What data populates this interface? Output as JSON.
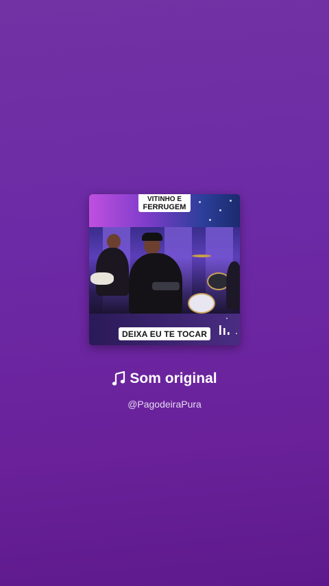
{
  "cover": {
    "title_line1": "VITINHO E",
    "title_line2": "FERRUGEM",
    "caption": "DEIXA EU TE TOCAR",
    "indicator_icon": "audio-bars-icon"
  },
  "sound": {
    "icon": "music-note-icon",
    "title": "Som original",
    "author": "@PagodeiraPura"
  },
  "colors": {
    "background_top": "#7232a3",
    "background_bottom": "#5e1a8c",
    "text": "#ffffff"
  }
}
